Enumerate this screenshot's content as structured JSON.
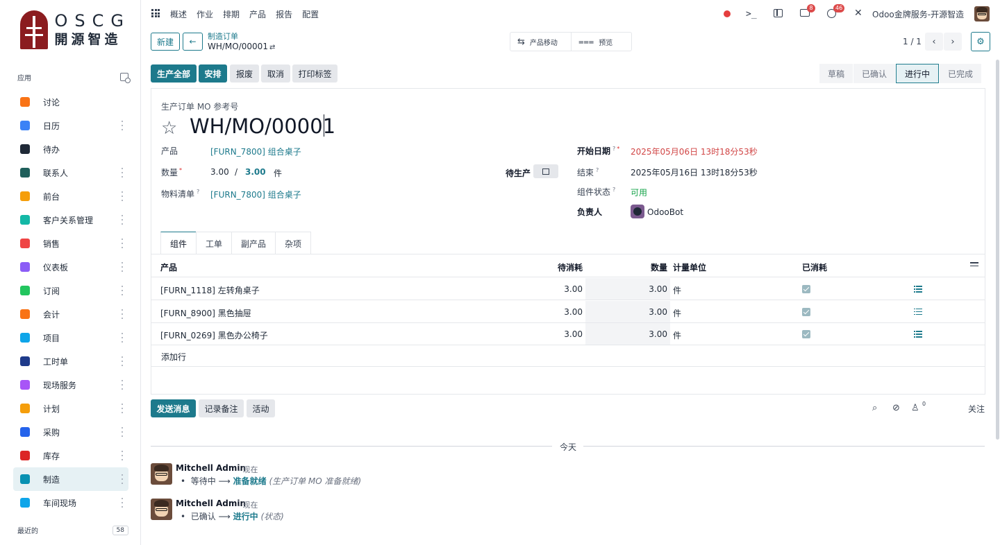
{
  "sidebar": {
    "logo_en": "OSCG",
    "logo_cn": "開源智造",
    "apps_label": "应用",
    "items": [
      {
        "label": "讨论",
        "icon": "discuss-icon",
        "color": "#f97316",
        "dots": false
      },
      {
        "label": "日历",
        "icon": "calendar-icon",
        "color": "#3b82f6",
        "dots": true
      },
      {
        "label": "待办",
        "icon": "todo-icon",
        "color": "#1f2937",
        "dots": false
      },
      {
        "label": "联系人",
        "icon": "contacts-icon",
        "color": "#1f5f5b",
        "dots": true
      },
      {
        "label": "前台",
        "icon": "frontdesk-icon",
        "color": "#f59e0b",
        "dots": true
      },
      {
        "label": "客户关系管理",
        "icon": "crm-icon",
        "color": "#14b8a6",
        "dots": true
      },
      {
        "label": "销售",
        "icon": "sales-icon",
        "color": "#ef4444",
        "dots": true
      },
      {
        "label": "仪表板",
        "icon": "dashboard-icon",
        "color": "#8b5cf6",
        "dots": true
      },
      {
        "label": "订阅",
        "icon": "subscription-icon",
        "color": "#22c55e",
        "dots": true
      },
      {
        "label": "会计",
        "icon": "accounting-icon",
        "color": "#f97316",
        "dots": true
      },
      {
        "label": "项目",
        "icon": "project-icon",
        "color": "#0ea5e9",
        "dots": true
      },
      {
        "label": "工时单",
        "icon": "timesheet-icon",
        "color": "#1e3a8a",
        "dots": true
      },
      {
        "label": "现场服务",
        "icon": "field-service-icon",
        "color": "#a855f7",
        "dots": true
      },
      {
        "label": "计划",
        "icon": "planning-icon",
        "color": "#f59e0b",
        "dots": true
      },
      {
        "label": "采购",
        "icon": "purchase-icon",
        "color": "#2563eb",
        "dots": true
      },
      {
        "label": "库存",
        "icon": "inventory-icon",
        "color": "#dc2626",
        "dots": true
      },
      {
        "label": "制造",
        "icon": "manufacturing-icon",
        "color": "#0891b2",
        "dots": true,
        "active": true
      },
      {
        "label": "车间现场",
        "icon": "shop-floor-icon",
        "color": "#0ea5e9",
        "dots": true
      }
    ],
    "recent_label": "最近的",
    "recent_count": "58"
  },
  "topnav": {
    "menu": [
      "概述",
      "作业",
      "排期",
      "产品",
      "报告",
      "配置"
    ],
    "chat_badge": "8",
    "activity_badge": "46",
    "company": "Odoo金牌服务-开源智造"
  },
  "control": {
    "new_label": "新建",
    "breadcrumb_parent": "制造订单",
    "breadcrumb_current": "WH/MO/00001",
    "smart_moves": "产品移动",
    "smart_preview": "预览",
    "pager": "1 / 1"
  },
  "actions": {
    "produce_all": "生产全部",
    "plan": "安排",
    "scrap": "报废",
    "cancel": "取消",
    "print_labels": "打印标签"
  },
  "statusbar": [
    "草稿",
    "已确认",
    "进行中",
    "已完成"
  ],
  "form": {
    "ref_label": "生产订单 MO 参考号",
    "title": "WH/MO/00001",
    "product_label": "产品",
    "product_value": "[FURN_7800] 组合桌子",
    "qty_label": "数量",
    "qty_produced": "3.00",
    "qty_sep": "/",
    "qty_total": "3.00",
    "qty_uom": "件",
    "bom_label": "物料清单",
    "bom_value": "[FURN_7800] 组合桌子",
    "to_produce_label": "待生产",
    "start_label": "开始日期",
    "start_value": "2025年05月06日 13时18分53秒",
    "end_label": "结束",
    "end_value": "2025年05月16日 13时18分53秒",
    "component_status_label": "组件状态",
    "component_status_value": "可用",
    "responsible_label": "负责人",
    "responsible_value": "OdooBot",
    "help_mark": "?",
    "required_mark": "*"
  },
  "tabs": [
    "组件",
    "工单",
    "副产品",
    "杂项"
  ],
  "table": {
    "headers": {
      "product": "产品",
      "to_consume": "待消耗",
      "quantity": "数量",
      "uom": "计量单位",
      "consumed": "已消耗"
    },
    "rows": [
      {
        "product": "[FURN_1118] 左转角桌子",
        "to_consume": "3.00",
        "quantity": "3.00",
        "uom": "件",
        "consumed": true
      },
      {
        "product": "[FURN_8900] 黑色抽屉",
        "to_consume": "3.00",
        "quantity": "3.00",
        "uom": "件",
        "consumed": true
      },
      {
        "product": "[FURN_0269] 黑色办公椅子",
        "to_consume": "3.00",
        "quantity": "3.00",
        "uom": "件",
        "consumed": true
      }
    ],
    "add_line": "添加行"
  },
  "chatter": {
    "send_message": "发送消息",
    "log_note": "记录备注",
    "activity": "活动",
    "followers_count": "0",
    "follow": "关注",
    "today": "今天",
    "messages": [
      {
        "author": "Mitchell Admin",
        "time": "- 现在",
        "from": "等待中",
        "arrow": "⟶",
        "to": "准备就绪",
        "note": "(生产订单 MO 准备就绪)"
      },
      {
        "author": "Mitchell Admin",
        "time": "- 现在",
        "from": "已确认",
        "arrow": "⟶",
        "to": "进行中",
        "note": "(状态)"
      }
    ]
  },
  "colors": {
    "accent": "#1d7a8c",
    "danger": "#dc4a4a",
    "success": "#16a34a"
  }
}
